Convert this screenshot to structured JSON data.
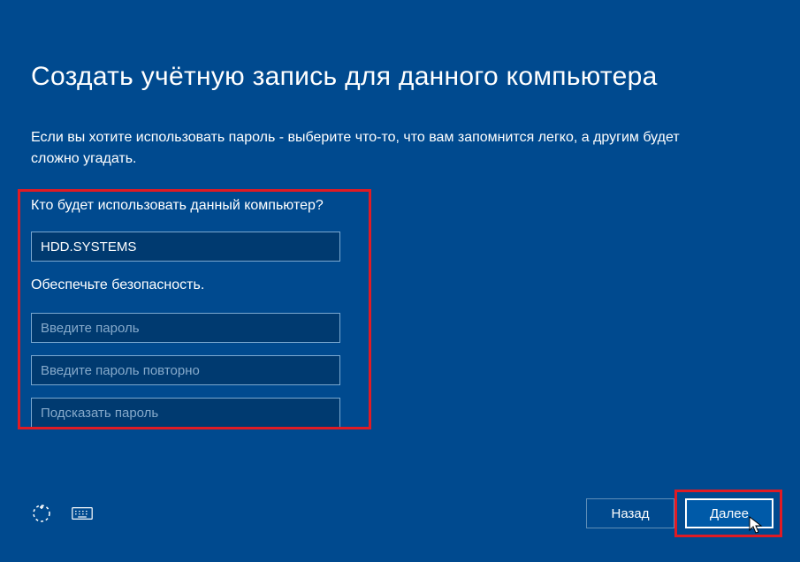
{
  "title": "Создать учётную запись для данного компьютера",
  "description": "Если вы хотите использовать пароль - выберите что-то, что вам запомнится легко, а другим будет сложно угадать.",
  "promptWho": "Кто будет использовать данный компьютер?",
  "username": {
    "value": "HDD.SYSTEMS"
  },
  "promptSecurity": "Обеспечьте безопасность.",
  "password": {
    "placeholder": "Введите пароль"
  },
  "passwordRepeat": {
    "placeholder": "Введите пароль повторно"
  },
  "passwordHint": {
    "placeholder": "Подсказать пароль"
  },
  "buttons": {
    "back": "Назад",
    "next": "Далее"
  }
}
